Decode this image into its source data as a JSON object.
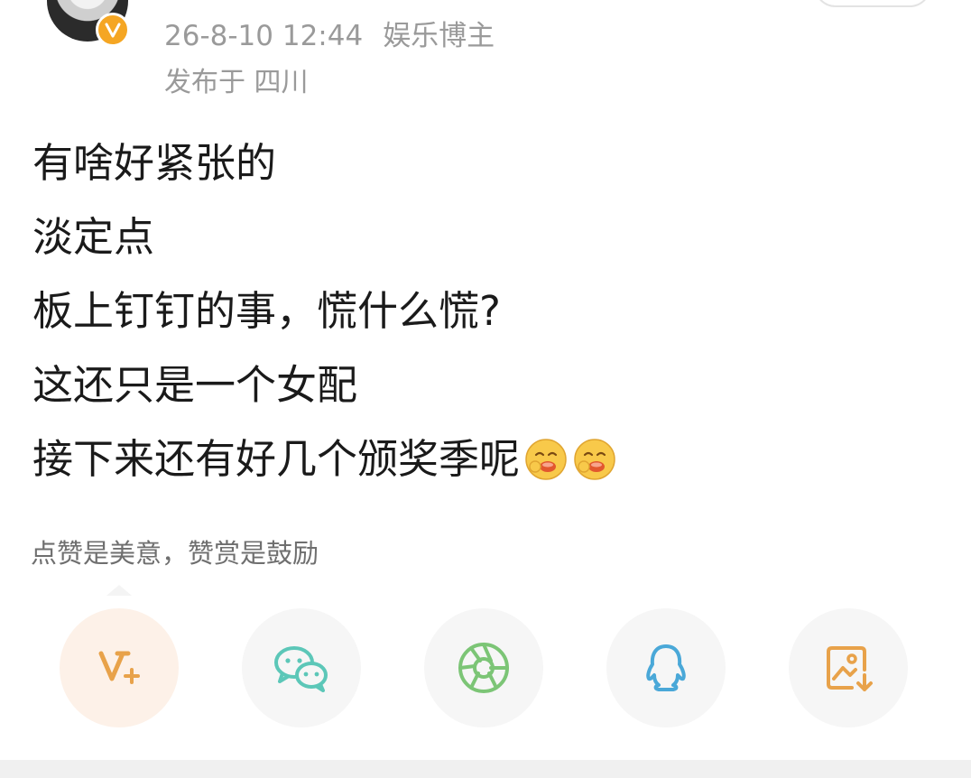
{
  "post_header": {
    "timestamp": "26-8-10 12:44",
    "author_tag": "娱乐博主",
    "location": "发布于 四川"
  },
  "post_body": {
    "lines": [
      "有啥好紧张的",
      "淡定点",
      "板上钉钉的事，慌什么慌?",
      "这还只是一个女配",
      "接下来还有好几个颁奖季呢"
    ],
    "trailing_emojis": [
      "drooling-face-emoji",
      "drooling-face-emoji"
    ]
  },
  "reward_hint": "点赞是美意，赞赏是鼓励",
  "share_row": [
    {
      "icon": "v-plus-icon",
      "color": "#e8a24a"
    },
    {
      "icon": "wechat-icon",
      "color": "#5cc7b8"
    },
    {
      "icon": "moments-icon",
      "color": "#7cc576"
    },
    {
      "icon": "qq-icon",
      "color": "#4aa8d8"
    },
    {
      "icon": "save-image-icon",
      "color": "#e8a24a"
    }
  ],
  "colors": {
    "accent_orange": "#e8a24a",
    "meta_gray": "#9a9a9a",
    "body_text": "#1a1a1a",
    "verified_badge": "#f5a623"
  }
}
